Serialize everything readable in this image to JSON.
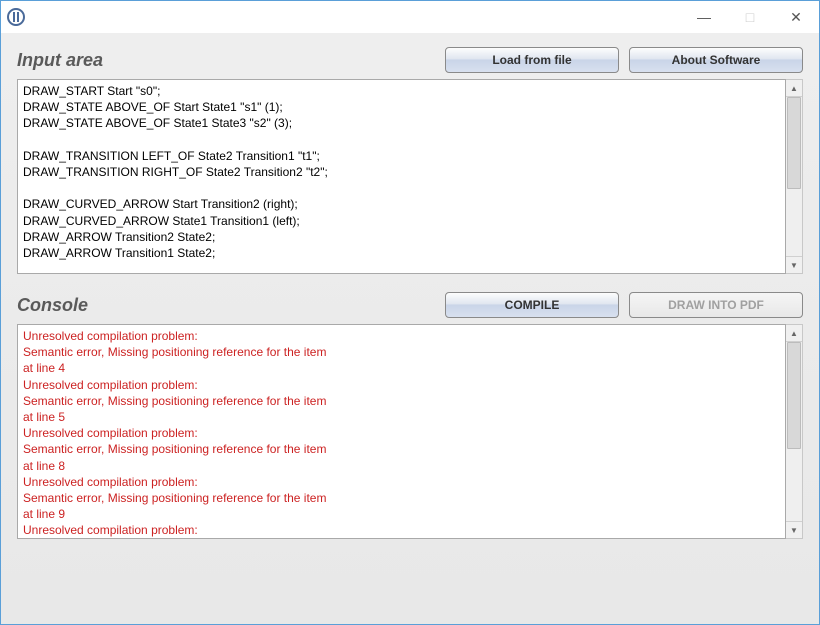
{
  "window": {
    "minimize_glyph": "—",
    "maximize_glyph": "□",
    "close_glyph": "✕"
  },
  "input_section": {
    "title": "Input area",
    "load_button": "Load from file",
    "about_button": "About Software",
    "code": "DRAW_START Start \"s0\";\nDRAW_STATE ABOVE_OF Start State1 \"s1\" (1);\nDRAW_STATE ABOVE_OF State1 State3 \"s2\" (3);\n\nDRAW_TRANSITION LEFT_OF State2 Transition1 \"t1\";\nDRAW_TRANSITION RIGHT_OF State2 Transition2 \"t2\";\n\nDRAW_CURVED_ARROW Start Transition2 (right);\nDRAW_CURVED_ARROW State1 Transition1 (left);\nDRAW_ARROW Transition2 State2;\nDRAW_ARROW Transition1 State2;"
  },
  "console_section": {
    "title": "Console",
    "compile_button": "COMPILE",
    "pdf_button": "DRAW INTO PDF",
    "lines": [
      "Unresolved compilation problem:",
      "Semantic error, Missing positioning reference for the item",
      "at line 4",
      "Unresolved compilation problem:",
      "Semantic error, Missing positioning reference for the item",
      "at line 5",
      "Unresolved compilation problem:",
      "Semantic error, Missing positioning reference for the item",
      "at line 8",
      "Unresolved compilation problem:",
      "Semantic error, Missing positioning reference for the item",
      "at line 9",
      "Unresolved compilation problem:"
    ]
  }
}
